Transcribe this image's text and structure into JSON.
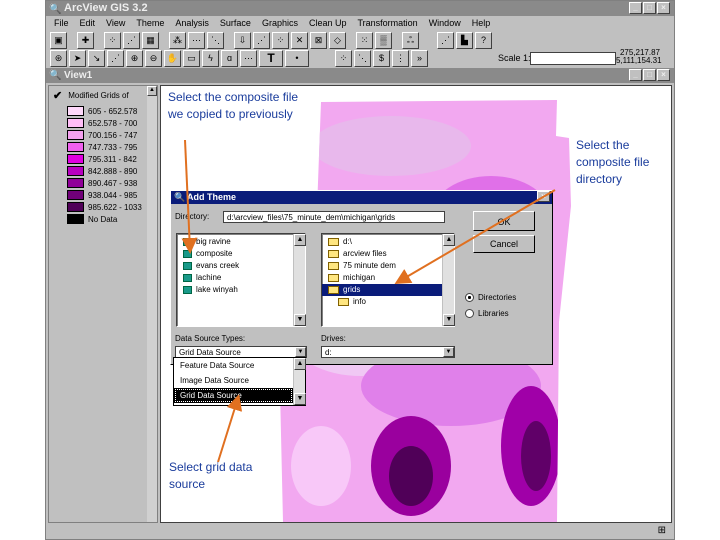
{
  "app": {
    "title": "ArcView GIS 3.2"
  },
  "menu": [
    "File",
    "Edit",
    "View",
    "Theme",
    "Analysis",
    "Surface",
    "Graphics",
    "Clean Up",
    "Transformation",
    "Window",
    "Help"
  ],
  "toolbar": {
    "scale_label": "Scale 1:",
    "scale_value": "",
    "coord_x": "275,217.87",
    "coord_y": "5,111,154.31"
  },
  "view": {
    "title": "View1"
  },
  "legend": {
    "theme_name": "Modified Grids of",
    "items": [
      {
        "label": "605 - 652.578",
        "color": "#ffd9fb"
      },
      {
        "label": "652.578 - 700",
        "color": "#ffbdf7"
      },
      {
        "label": "700.156 - 747",
        "color": "#f5a0f0"
      },
      {
        "label": "747.733 - 795",
        "color": "#f060ee"
      },
      {
        "label": "795.311 - 842",
        "color": "#e000e0"
      },
      {
        "label": "842.888 - 890",
        "color": "#b800c0"
      },
      {
        "label": "890.467 - 938",
        "color": "#900098"
      },
      {
        "label": "938.044 - 985",
        "color": "#700078"
      },
      {
        "label": "985.622 - 1033",
        "color": "#500058"
      },
      {
        "label": "No Data",
        "color": "#000000"
      }
    ]
  },
  "dialog": {
    "title": "Add Theme",
    "directory_label": "Directory:",
    "directory_value": "d:\\arcview_files\\75_minute_dem\\michigan\\grids",
    "files": [
      "big ravine",
      "composite",
      "evans creek",
      "lachine",
      "lake winyah"
    ],
    "folders": [
      "d:\\",
      "arcview files",
      "75 minute dem",
      "michigan",
      "grids",
      "info"
    ],
    "selected_folder": "grids",
    "ok": "OK",
    "cancel": "Cancel",
    "radio_directories": "Directories",
    "radio_libraries": "Libraries",
    "data_source_label": "Data Source Types:",
    "data_source_value": "Grid Data Source",
    "drives_label": "Drives:",
    "drives_value": "d:",
    "data_source_options": [
      "Feature Data Source",
      "Image Data Source",
      "Grid Data Source"
    ]
  },
  "annotations": {
    "composite_file": "Select the composite file we copied to previously",
    "directory": "Select the composite file directory",
    "grid_source": "Select grid data source"
  }
}
